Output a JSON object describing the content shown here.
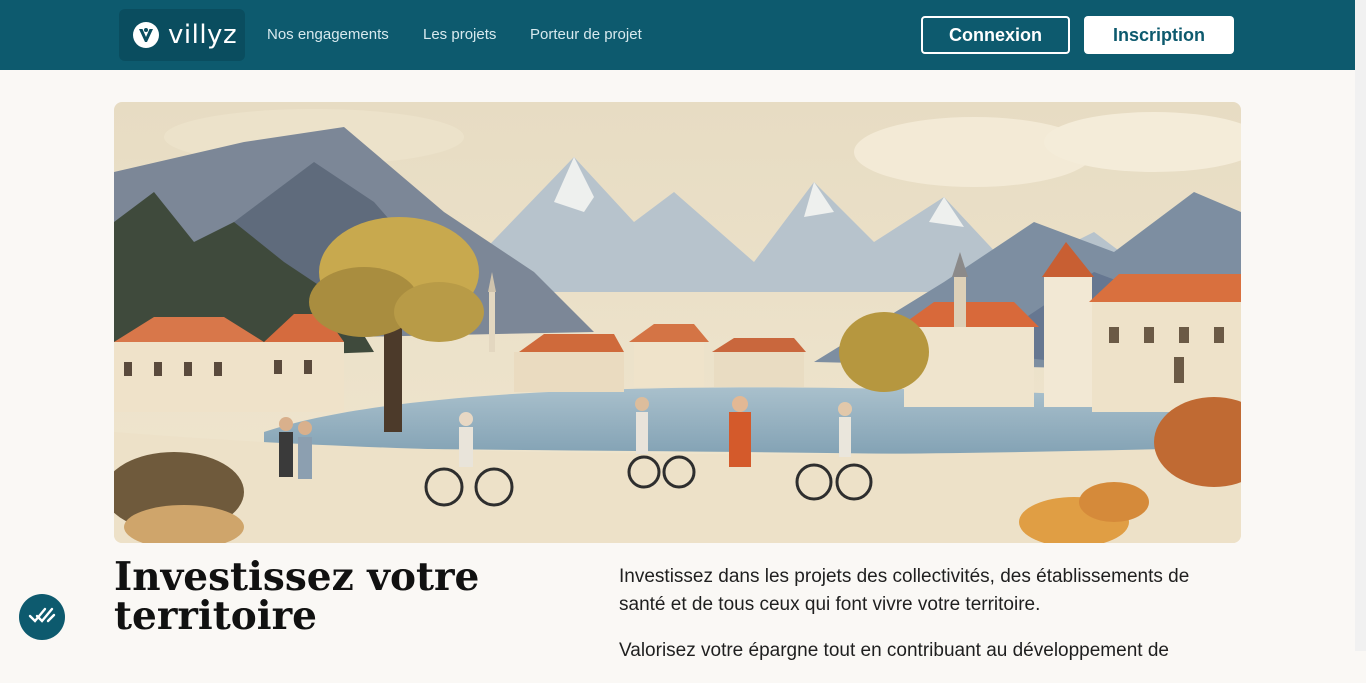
{
  "header": {
    "logo_text": "villyz",
    "nav": [
      {
        "label": "Nos engagements"
      },
      {
        "label": "Les projets"
      },
      {
        "label": "Porteur de projet"
      }
    ],
    "login_label": "Connexion",
    "signup_label": "Inscription"
  },
  "hero": {
    "image_icon": "illustration-mountain-village-lake"
  },
  "main": {
    "title": "Investissez votre territoire",
    "paragraphs": [
      "Investissez dans les projets des collectivités, des établissements de santé et de tous ceux qui font vivre votre territoire.",
      "Valorisez votre épargne tout en contribuant au développement de"
    ]
  },
  "floating_button": {
    "icon": "double-check-icon"
  },
  "colors": {
    "brand": "#0d5a6e",
    "background": "#faf8f5"
  }
}
